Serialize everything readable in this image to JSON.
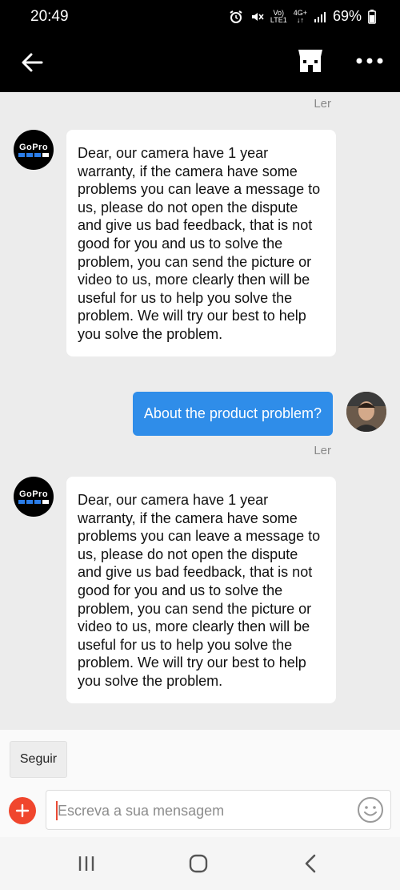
{
  "status_bar": {
    "time": "20:49",
    "network_top": "Vo)",
    "network_bottom": "LTE1",
    "network_type": "4G+",
    "battery": "69%"
  },
  "header": {
    "back_icon": "arrow-left-icon",
    "store_icon": "store-icon",
    "more_icon": "more-dots-icon"
  },
  "brand_avatar": {
    "logo_text": "GoPro"
  },
  "messages": [
    {
      "from": "seller",
      "read_label": "Ler",
      "text": "Dear, our camera have 1 year warranty, if the camera have some problems you can leave a message to us, please do not open the dispute and give us bad feedback, that is not good for you and us to solve the problem,  you can send the picture or video to us, more clearly then will be useful for us to help you solve the problem. We will try our best to help you solve the problem."
    },
    {
      "from": "user",
      "text": "About the product problem?",
      "read_label": "Ler"
    },
    {
      "from": "seller",
      "text": "Dear, our camera have 1 year warranty, if the camera have some problems you can leave a message to us, please do not open the dispute and give us bad feedback, that is not good for you and us to solve the problem,  you can send the picture or video to us, more clearly then will be useful for us to help you solve the problem. We will try our best to help you solve the problem."
    }
  ],
  "composer": {
    "follow_label": "Seguir",
    "placeholder": "Escreva a sua mensagem",
    "add_icon": "plus-icon",
    "emoji_icon": "smiley-icon"
  },
  "colors": {
    "accent_blue": "#2f8de9",
    "add_red": "#f0462d",
    "header_bg": "#000000"
  }
}
